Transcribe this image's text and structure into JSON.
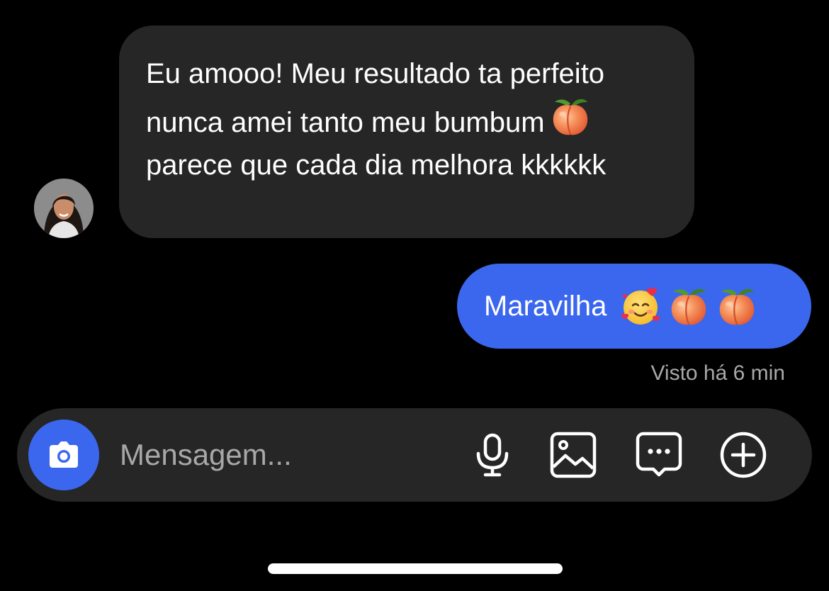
{
  "conversation": {
    "received_message": {
      "text_before_emoji": "Eu amooo! Meu resultado ta perfeito nunca amei tanto meu bumbum",
      "emoji": "peach-emoji",
      "text_after_emoji": "parece que cada dia melhora kkkkkk"
    },
    "sent_message": {
      "text": "Maravilha",
      "emojis": [
        "smiling-face-with-hearts-emoji",
        "peach-emoji",
        "peach-emoji"
      ]
    },
    "seen_status": "Visto há 6 min"
  },
  "composer": {
    "placeholder": "Mensagem...",
    "camera_icon": "camera-icon",
    "tools": [
      "microphone-icon",
      "gallery-icon",
      "sticker-icon",
      "add-icon"
    ]
  },
  "colors": {
    "background": "#000000",
    "received_bubble": "#262626",
    "sent_bubble": "#3b67ee",
    "muted_text": "#a8a8a8"
  }
}
